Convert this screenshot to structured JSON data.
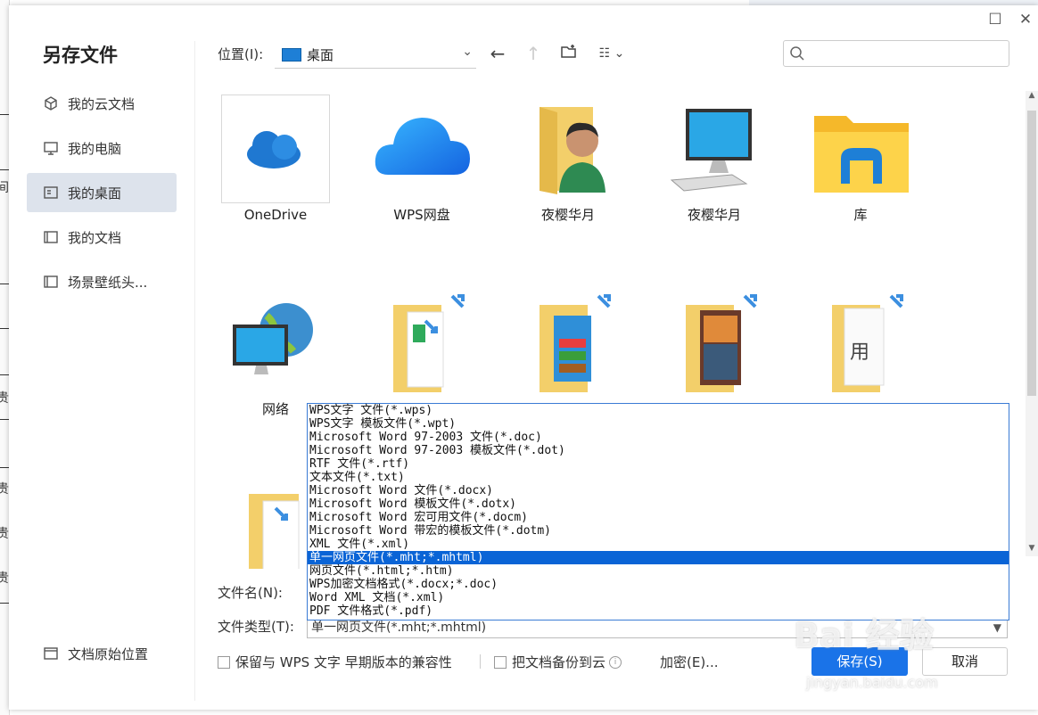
{
  "dialog": {
    "title": "另存文件",
    "maximize_icon": "maximize-icon",
    "close_icon": "close-icon"
  },
  "background": {
    "left_chars": [
      "间",
      "贵",
      "贵",
      "贵",
      "贵"
    ]
  },
  "sidebar": {
    "items": [
      {
        "label": "我的云文档",
        "icon": "cloud-doc-icon",
        "active": false
      },
      {
        "label": "我的电脑",
        "icon": "computer-icon",
        "active": false
      },
      {
        "label": "我的桌面",
        "icon": "desktop-icon",
        "active": true
      },
      {
        "label": "我的文档",
        "icon": "folder-icon",
        "active": false
      },
      {
        "label": "场景壁纸头...",
        "icon": "folder-icon",
        "active": false
      }
    ],
    "bottom": {
      "label": "文档原始位置",
      "icon": "folder-icon"
    }
  },
  "toolbar": {
    "location_label": "位置(I):",
    "location_value": "桌面",
    "back_icon": "back-arrow-icon",
    "up_icon": "up-arrow-icon",
    "new_folder_icon": "new-folder-icon",
    "view_icon": "view-mode-icon",
    "search_placeholder": ""
  },
  "files": [
    {
      "label": "OneDrive",
      "icon": "onedrive-icon"
    },
    {
      "label": "WPS网盘",
      "icon": "wps-cloud-icon"
    },
    {
      "label": "夜樱华月",
      "icon": "user-folder-icon"
    },
    {
      "label": "夜樱华月",
      "icon": "this-pc-icon"
    },
    {
      "label": "库",
      "icon": "library-icon"
    },
    {
      "label": "网络",
      "icon": "network-icon"
    },
    {
      "label": "",
      "icon": "folder-shortcut-icon"
    },
    {
      "label": "",
      "icon": "folder-shortcut-icon"
    },
    {
      "label": "",
      "icon": "folder-shortcut-icon"
    },
    {
      "label": "",
      "icon": "folder-shortcut-icon"
    },
    {
      "label": "",
      "icon": "folder-shortcut-icon"
    }
  ],
  "file_type_list": [
    "WPS文字 文件(*.wps)",
    "WPS文字 模板文件(*.wpt)",
    "Microsoft Word 97-2003 文件(*.doc)",
    "Microsoft Word 97-2003 模板文件(*.dot)",
    "RTF 文件(*.rtf)",
    "文本文件(*.txt)",
    "Microsoft Word 文件(*.docx)",
    "Microsoft Word 模板文件(*.dotx)",
    "Microsoft Word 宏可用文件(*.docm)",
    "Microsoft Word 带宏的模板文件(*.dotm)",
    "XML 文件(*.xml)",
    "单一网页文件(*.mht;*.mhtml)",
    "网页文件(*.html;*.htm)",
    "WPS加密文档格式(*.docx;*.doc)",
    "Word XML 文档(*.xml)",
    "PDF 文件格式(*.pdf)"
  ],
  "file_type_highlight_index": 11,
  "form": {
    "filename_label": "文件名(N):",
    "filetype_label": "文件类型(T):",
    "filetype_value": "单一网页文件(*.mht;*.mhtml)"
  },
  "options": {
    "compat_label": "保留与 WPS 文字 早期版本的兼容性",
    "backup_label": "把文档备份到云",
    "encrypt_label": "加密(E)..."
  },
  "buttons": {
    "save": "保存(S)",
    "cancel": "取消"
  },
  "watermark": {
    "text": "Bai 经验",
    "sub": "jingyan.baidu.com"
  },
  "colors": {
    "accent": "#1a73e8",
    "highlight": "#0a64d6",
    "sidebar_active": "#dde3ec"
  }
}
